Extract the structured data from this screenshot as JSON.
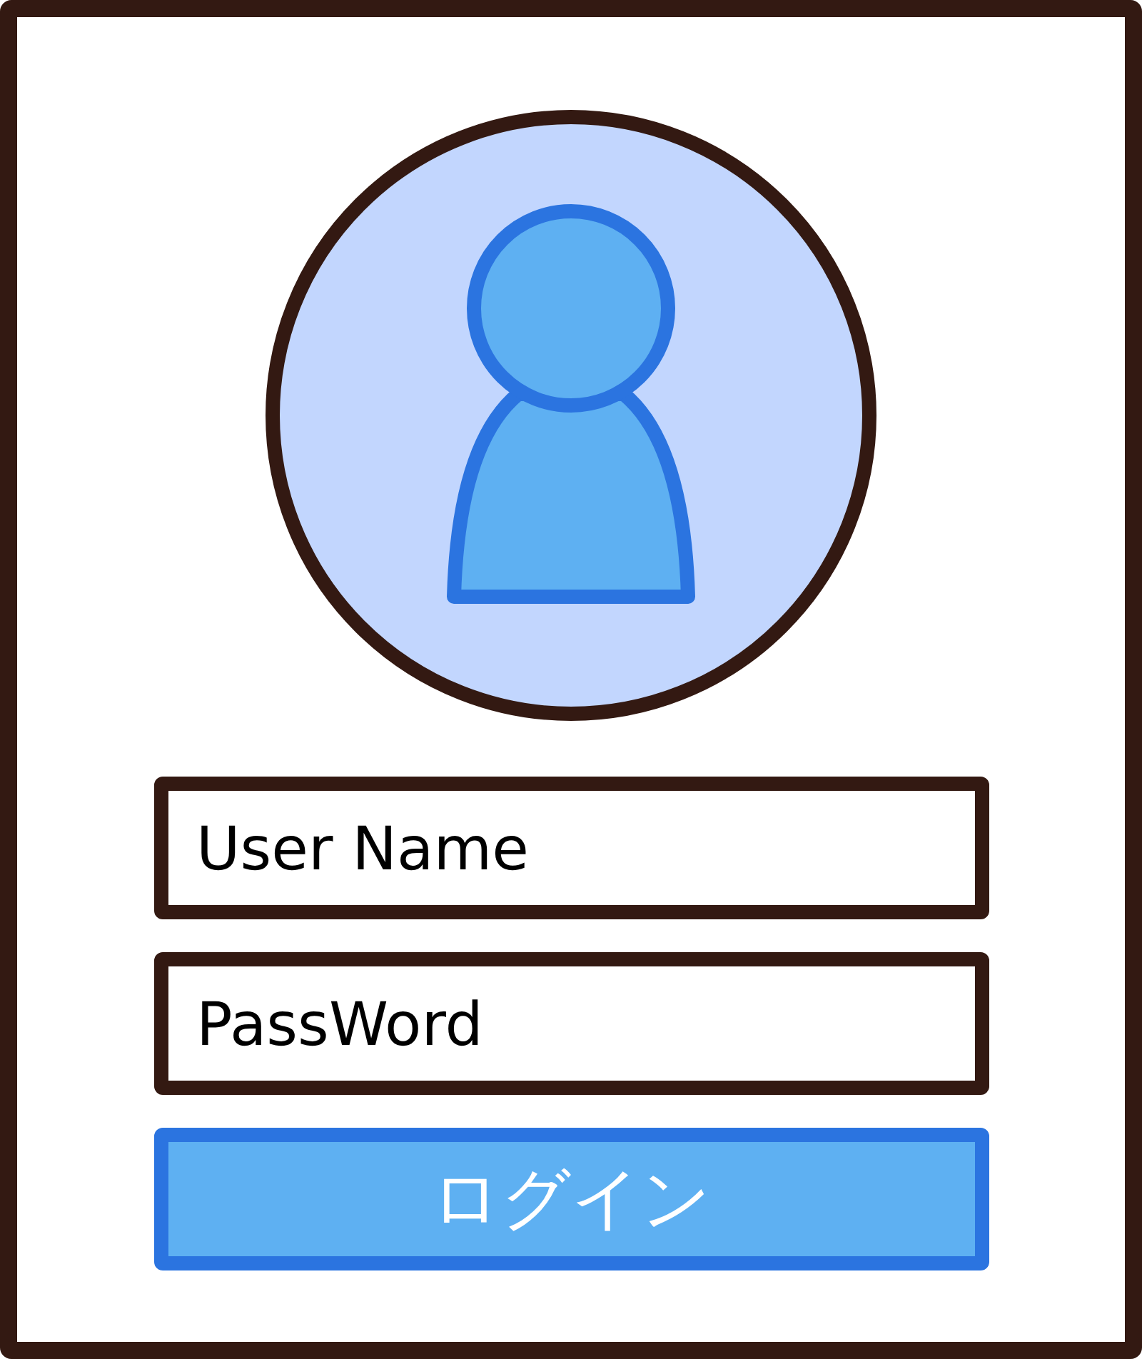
{
  "fields": [
    {
      "placeholder": "User Name"
    },
    {
      "placeholder": "PassWord"
    }
  ],
  "login_button": {
    "label": "ログイン"
  }
}
